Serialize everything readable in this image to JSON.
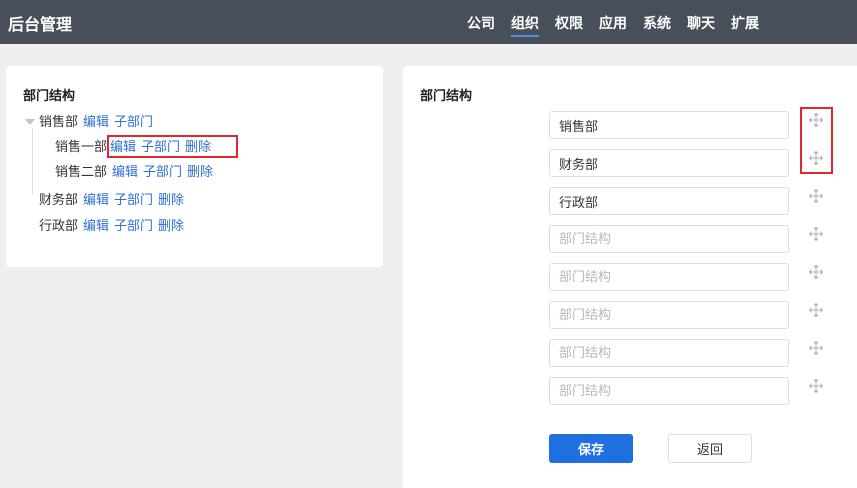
{
  "app": {
    "title": "后台管理"
  },
  "nav": {
    "items": [
      {
        "label": "公司",
        "active": false
      },
      {
        "label": "组织",
        "active": true
      },
      {
        "label": "权限",
        "active": false
      },
      {
        "label": "应用",
        "active": false
      },
      {
        "label": "系统",
        "active": false
      },
      {
        "label": "聊天",
        "active": false
      },
      {
        "label": "扩展",
        "active": false
      }
    ]
  },
  "left_panel": {
    "title": "部门结构",
    "tree": [
      {
        "name": "销售部",
        "actions": [
          "编辑",
          "子部门"
        ],
        "expanded": true
      },
      {
        "name": "销售一部",
        "actions": [
          "编辑",
          "子部门",
          "删除"
        ],
        "highlighted": true
      },
      {
        "name": "销售二部",
        "actions": [
          "编辑",
          "子部门",
          "删除"
        ]
      },
      {
        "name": "财务部",
        "actions": [
          "编辑",
          "子部门",
          "删除"
        ]
      },
      {
        "name": "行政部",
        "actions": [
          "编辑",
          "子部门",
          "删除"
        ]
      }
    ]
  },
  "right_panel": {
    "title": "部门结构",
    "fields": [
      {
        "value": "销售部",
        "placeholder": "部门结构"
      },
      {
        "value": "财务部",
        "placeholder": "部门结构"
      },
      {
        "value": "行政部",
        "placeholder": "部门结构"
      },
      {
        "value": "",
        "placeholder": "部门结构"
      },
      {
        "value": "",
        "placeholder": "部门结构"
      },
      {
        "value": "",
        "placeholder": "部门结构"
      },
      {
        "value": "",
        "placeholder": "部门结构"
      },
      {
        "value": "",
        "placeholder": "部门结构"
      }
    ],
    "drag_icon": "move-icon",
    "save_label": "保存",
    "back_label": "返回"
  },
  "colors": {
    "topbar": "#474f5a",
    "link": "#2d6fd4",
    "primary": "#1f6fe0",
    "highlight": "#e0282e"
  }
}
